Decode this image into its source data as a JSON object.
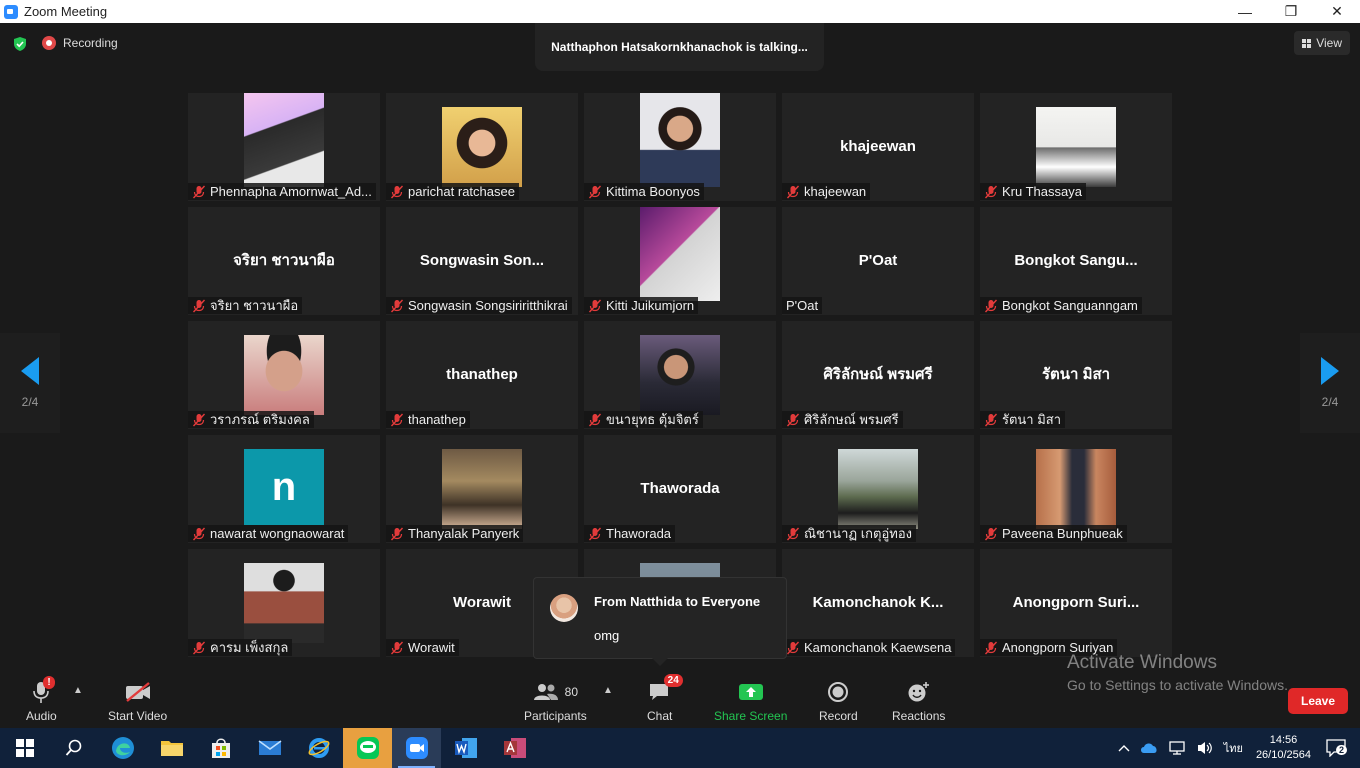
{
  "window": {
    "title": "Zoom Meeting",
    "minimize_label": "—",
    "maximize_label": "❐",
    "close_label": "✕"
  },
  "header": {
    "recording_label": "Recording",
    "talking_label": "Natthaphon Hatsakornkhanachok is talking...",
    "view_label": "View"
  },
  "pagination": {
    "left_page": "2/4",
    "right_page": "2/4"
  },
  "participants": [
    {
      "name": "Phennapha Amornwat_Ad...",
      "display": "",
      "muted": true,
      "photo": "p1"
    },
    {
      "name": "parichat ratchasee",
      "display": "",
      "muted": true,
      "photo": "p2"
    },
    {
      "name": "Kittima Boonyos",
      "display": "",
      "muted": true,
      "photo": "p3"
    },
    {
      "name": "khajeewan",
      "display": "khajeewan",
      "muted": true,
      "photo": ""
    },
    {
      "name": "Kru Thassaya",
      "display": "",
      "muted": true,
      "photo": "p5"
    },
    {
      "name": "จริยา ชาวนาผือ",
      "display": "จริยา ชาวนาผือ",
      "muted": true,
      "photo": ""
    },
    {
      "name": "Songwasin Songsiriritthikrai",
      "display": "Songwasin  Son...",
      "muted": true,
      "photo": ""
    },
    {
      "name": "Kitti Juikumjorn",
      "display": "",
      "muted": true,
      "photo": "p8"
    },
    {
      "name": "P'Oat",
      "display": "P'Oat",
      "muted": false,
      "photo": ""
    },
    {
      "name": "Bongkot Sanguanngam",
      "display": "Bongkot  Sangu...",
      "muted": true,
      "photo": ""
    },
    {
      "name": "วราภรณ์ ตริมงคล",
      "display": "",
      "muted": true,
      "photo": "p11"
    },
    {
      "name": "thanathep",
      "display": "thanathep",
      "muted": true,
      "photo": ""
    },
    {
      "name": "ขนายุทธ ตุ้มจิตร์",
      "display": "",
      "muted": true,
      "photo": "p13"
    },
    {
      "name": "ศิริลักษณ์ พรมศรี",
      "display": "ศิริลักษณ์ พรมศรี",
      "muted": true,
      "photo": ""
    },
    {
      "name": "รัตนา มิสา",
      "display": "รัตนา มิสา",
      "muted": true,
      "photo": ""
    },
    {
      "name": "nawarat wongnaowarat",
      "display": "",
      "muted": true,
      "photo": "n"
    },
    {
      "name": "Thanyalak Panyerk",
      "display": "",
      "muted": true,
      "photo": "p17"
    },
    {
      "name": "Thaworada",
      "display": "Thaworada",
      "muted": true,
      "photo": ""
    },
    {
      "name": "ณิชานาฏ เกตุอู่ทอง",
      "display": "",
      "muted": true,
      "photo": "p19"
    },
    {
      "name": "Paveena Bunphueak",
      "display": "",
      "muted": true,
      "photo": "p20"
    },
    {
      "name": "คารม เพ็งสกุล",
      "display": "",
      "muted": true,
      "photo": "p21"
    },
    {
      "name": "Worawit",
      "display": "Worawit",
      "muted": true,
      "photo": ""
    },
    {
      "name": "",
      "display": "",
      "muted": false,
      "photo": "p23"
    },
    {
      "name": "Kamonchanok Kaewsena",
      "display": "Kamonchanok  K...",
      "muted": true,
      "photo": ""
    },
    {
      "name": "Anongporn Suriyan",
      "display": "Anongporn  Suri...",
      "muted": true,
      "photo": ""
    }
  ],
  "avatar_letter": "n",
  "chat_popup": {
    "from": "From Natthida to Everyone",
    "message": "omg"
  },
  "toolbar": {
    "audio_label": "Audio",
    "audio_alert": "!",
    "video_label": "Start Video",
    "participants_label": "Participants",
    "participants_count": "80",
    "chat_label": "Chat",
    "chat_badge": "24",
    "share_label": "Share Screen",
    "record_label": "Record",
    "reactions_label": "Reactions",
    "leave_label": "Leave"
  },
  "watermark": {
    "line1": "Activate Windows",
    "line2": "Go to Settings to activate Windows."
  },
  "taskbar": {
    "language": "ไทย",
    "time": "14:56",
    "date": "26/10/2564",
    "notification_count": "2"
  },
  "colors": {
    "accent_blue": "#1a9cf0",
    "share_green": "#23c552",
    "leave_red": "#e02828",
    "mic_off_red": "#e23b3b"
  }
}
